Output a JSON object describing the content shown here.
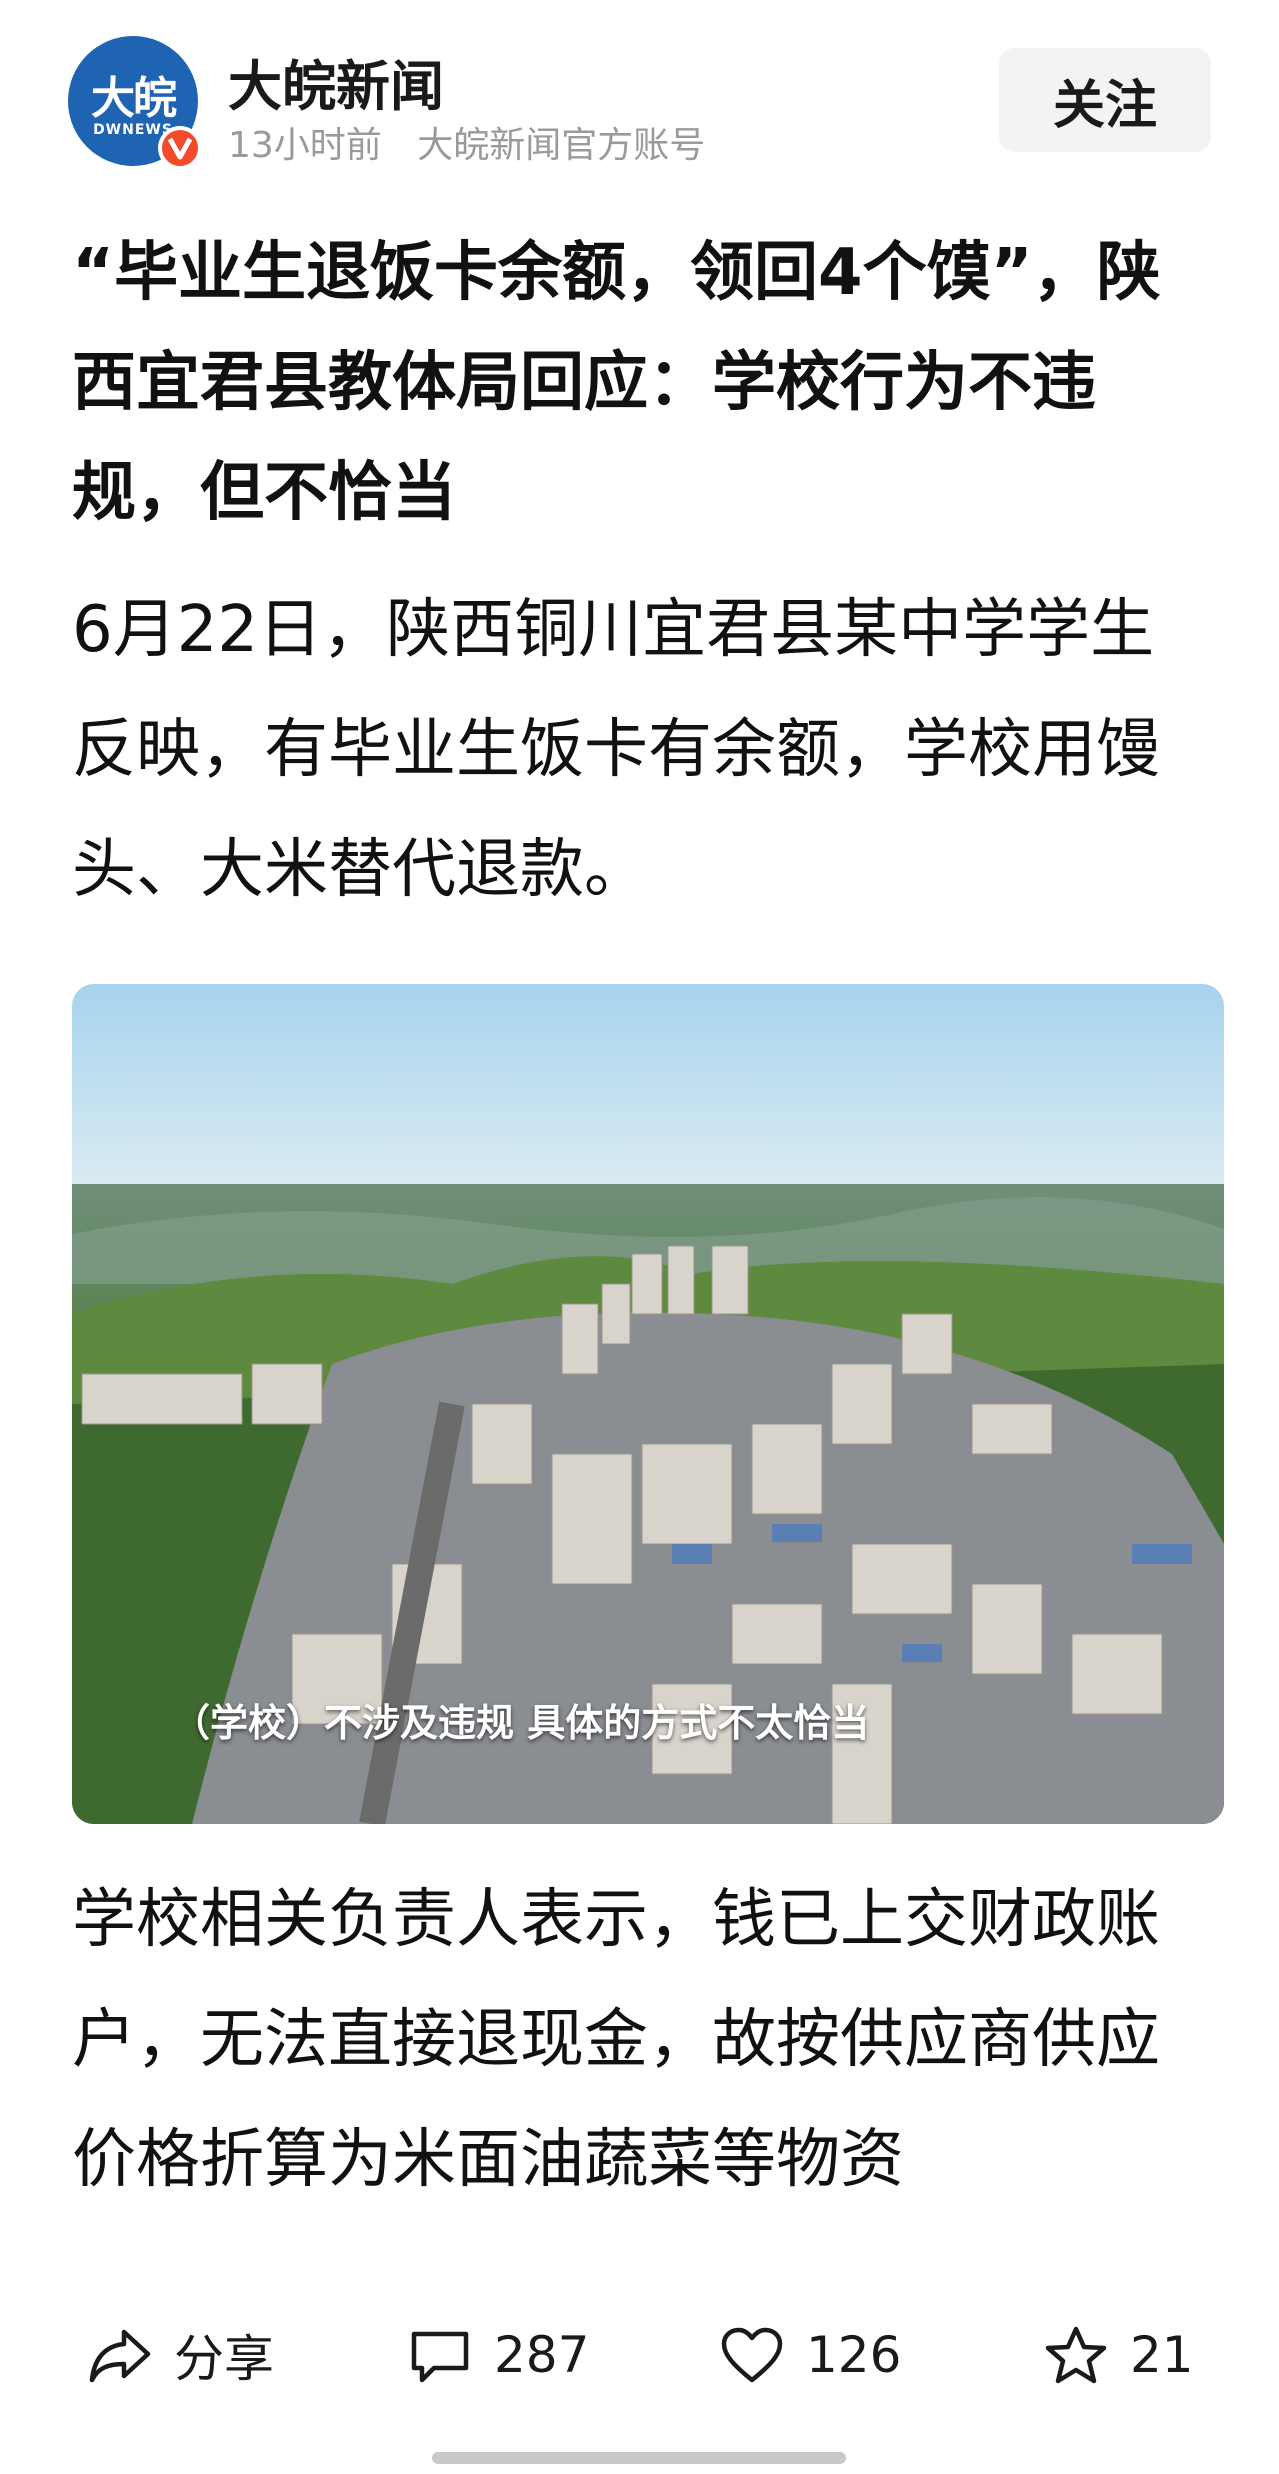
{
  "header": {
    "logo_text": "大皖",
    "logo_sub": "DWNEWS",
    "account_name": "大皖新闻",
    "time_ago": "13小时前",
    "account_desc": "大皖新闻官方账号",
    "follow_label": "关注"
  },
  "article": {
    "title": "“毕业生退饭卡余额，领回4个馍”，陕西宜君县教体局回应：学校行为不违规，但不恰当",
    "para1": "6月22日，陕西铜川宜君县某中学学生反映，有毕业生饭卡有余额，学校用馒头、大米替代退款。",
    "image_caption": "（学校）不涉及违规 具体的方式不太恰当",
    "para2": "学校相关负责人表示，钱已上交财政账户，无法直接退现金，故按供应商供应价格折算为米面油蔬菜等物资"
  },
  "actions": {
    "share_label": "分享",
    "comment_count": "287",
    "like_count": "126",
    "favorite_count": "21"
  },
  "colors": {
    "brand_blue": "#1f64b3",
    "verified_red": "#f24a2b",
    "meta_gray": "#9a9a9a"
  }
}
